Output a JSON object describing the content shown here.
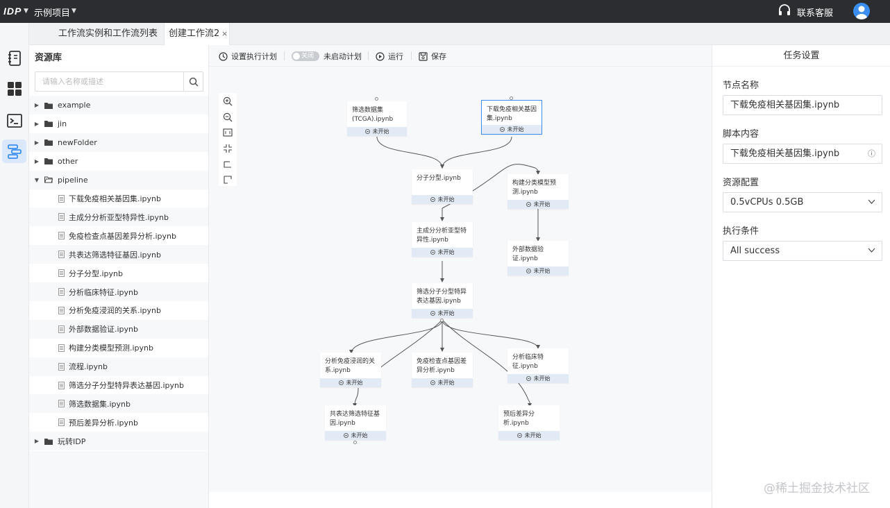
{
  "topbar": {
    "logo": "IDP",
    "project": "示例项目",
    "support": "联系客服"
  },
  "tabs": [
    {
      "label": "工作流实例和工作流列表"
    },
    {
      "label": "创建工作流2",
      "close": "×"
    }
  ],
  "sidebar": {
    "title": "资源库",
    "search_placeholder": "请输入名称或描述",
    "tree": [
      {
        "label": "example",
        "type": "folder",
        "expanded": false
      },
      {
        "label": "jin",
        "type": "folder",
        "expanded": false
      },
      {
        "label": "newFolder",
        "type": "folder",
        "expanded": false
      },
      {
        "label": "other",
        "type": "folder",
        "expanded": false
      },
      {
        "label": "pipeline",
        "type": "folder",
        "expanded": true
      },
      {
        "label": "下载免疫相关基因集.ipynb",
        "type": "file"
      },
      {
        "label": "主成分分析亚型特异性.ipynb",
        "type": "file"
      },
      {
        "label": "免疫检查点基因差异分析.ipynb",
        "type": "file"
      },
      {
        "label": "共表达筛选特征基因.ipynb",
        "type": "file"
      },
      {
        "label": "分子分型.ipynb",
        "type": "file"
      },
      {
        "label": "分析临床特征.ipynb",
        "type": "file"
      },
      {
        "label": "分析免疫浸润的关系.ipynb",
        "type": "file"
      },
      {
        "label": "外部数据验证.ipynb",
        "type": "file"
      },
      {
        "label": "构建分类模型预测.ipynb",
        "type": "file"
      },
      {
        "label": "流程.ipynb",
        "type": "file"
      },
      {
        "label": "筛选分子分型特异表达基因.ipynb",
        "type": "file"
      },
      {
        "label": "筛选数据集.ipynb",
        "type": "file"
      },
      {
        "label": "预后差异分析.ipynb",
        "type": "file"
      },
      {
        "label": "玩转IDP",
        "type": "folder",
        "expanded": false
      }
    ]
  },
  "toolbar": {
    "schedule": "设置执行计划",
    "toggle_text": "关闭",
    "plan_status": "未启动计划",
    "run": "运行",
    "save": "保存"
  },
  "nodes": [
    {
      "label": "筛选数据集(TCGA).ipynb",
      "status": "未开始"
    },
    {
      "label": "下载免疫相关基因集.ipynb",
      "status": "未开始",
      "selected": true
    },
    {
      "label": "分子分型.ipynb",
      "status": "未开始"
    },
    {
      "label": "构建分类模型预测.ipynb",
      "status": "未开始"
    },
    {
      "label": "主成分分析亚型特异性.ipynb",
      "status": "未开始"
    },
    {
      "label": "外部数据验证.ipynb",
      "status": "未开始"
    },
    {
      "label": "筛选分子分型特异表达基因.ipynb",
      "status": "未开始"
    },
    {
      "label": "分析免疫浸润的关系.ipynb",
      "status": "未开始"
    },
    {
      "label": "免疫检查点基因差异分析.ipynb",
      "status": "未开始"
    },
    {
      "label": "分析临床特征.ipynb",
      "status": "未开始"
    },
    {
      "label": "共表达筛选特征基因.ipynb",
      "status": "未开始"
    },
    {
      "label": "预后差异分析.ipynb",
      "status": "未开始"
    }
  ],
  "panel": {
    "title": "任务设置",
    "node_name_label": "节点名称",
    "node_name": "下载免疫相关基因集.ipynb",
    "script_label": "脚本内容",
    "script": "下载免疫相关基因集.ipynb",
    "resource_label": "资源配置",
    "resource": "0.5vCPUs 0.5GB",
    "condition_label": "执行条件",
    "condition": "All success"
  },
  "watermark": "@稀土掘金技术社区",
  "colors": {
    "accent": "#3b8ef0",
    "topbar": "#2b2d31",
    "status_bg": "#e2ebf5"
  }
}
